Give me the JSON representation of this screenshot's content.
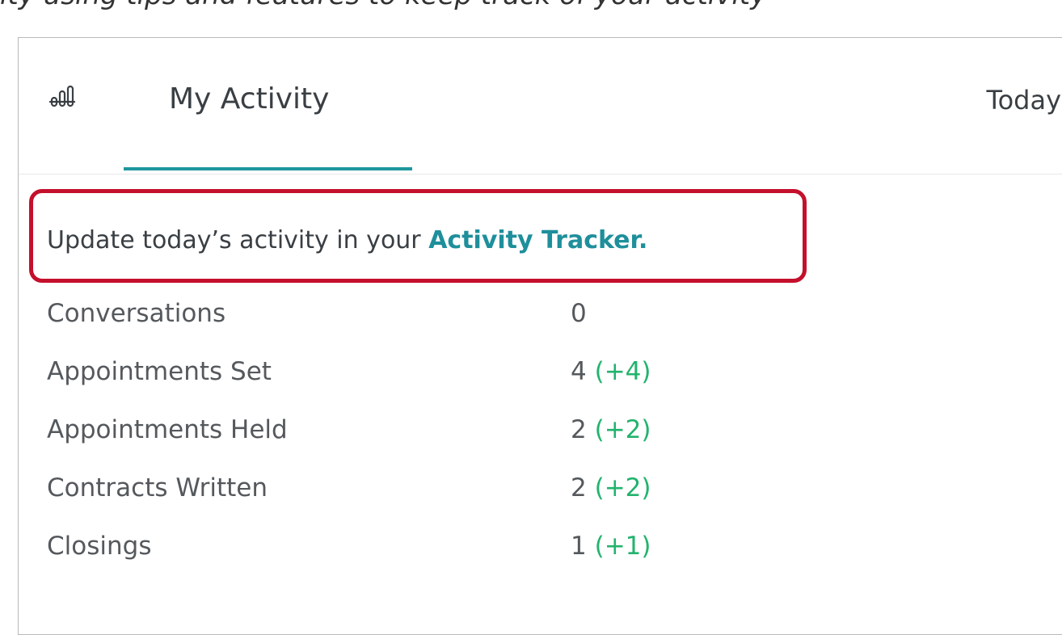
{
  "top_caption": "ity using tips and features to keep track of your activity",
  "header": {
    "tab_label": "My Activity",
    "period_label": "Today",
    "icon": "activity-icon"
  },
  "callout": {
    "prefix": "Update today’s activity in your",
    "link_label": "Activity Tracker."
  },
  "metrics": [
    {
      "label": "Conversations",
      "value": "0",
      "delta": ""
    },
    {
      "label": "Appointments Set",
      "value": "4",
      "delta": "(+4)"
    },
    {
      "label": "Appointments Held",
      "value": "2",
      "delta": "(+2)"
    },
    {
      "label": "Contracts Written",
      "value": "2",
      "delta": "(+2)"
    },
    {
      "label": "Closings",
      "value": "1",
      "delta": "(+1)"
    }
  ],
  "colors": {
    "accent": "#1e979c",
    "link": "#1e8f9b",
    "highlight_border": "#c4102c",
    "positive_delta": "#22b36d"
  }
}
